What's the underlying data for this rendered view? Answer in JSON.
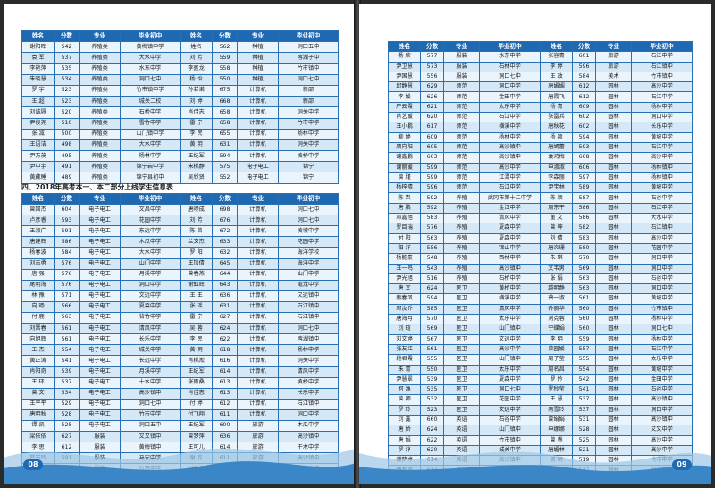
{
  "pages": {
    "left": {
      "page_number": "08",
      "table1": {
        "headers": [
          "姓名",
          "分数",
          "专业",
          "毕业初中",
          "姓名",
          "分数",
          "专业",
          "毕业初中"
        ],
        "rows": [
          [
            "谢阳晖",
            "542",
            "养殖类",
            "黄梅镇中学",
            "姓名",
            "562",
            "种植",
            "洞口五中"
          ],
          [
            "袁 军",
            "537",
            "养殖类",
            "大水中学",
            "刘 芳",
            "559",
            "种植",
            "蓉湖子中"
          ],
          [
            "李艳萍",
            "535",
            "养殖类",
            "水东中学",
            "李盈龙",
            "558",
            "种植",
            "竹市镇中"
          ],
          [
            "朱晓慧",
            "534",
            "养殖类",
            "洞口七中",
            "杨 怡",
            "550",
            "种植",
            "洞口七中"
          ],
          [
            "罗 宇",
            "523",
            "养殖类",
            "竹市镇中学",
            "孙若诺",
            "675",
            "计算机",
            "新邵"
          ],
          [
            "王 超",
            "523",
            "养殖类",
            "城关二校",
            "刘 婷",
            "668",
            "计算机",
            "新邵"
          ],
          [
            "刘诚珮",
            "520",
            "养殖类",
            "石桥中学",
            "肖佳志",
            "658",
            "计算机",
            "洞关中学"
          ],
          [
            "尹俊尧",
            "510",
            "养殖类",
            "雪竹中学",
            "雷 宁",
            "658",
            "计算机",
            "竹市中学"
          ],
          [
            "张 减",
            "500",
            "养殖类",
            "山门镇中学",
            "李 民",
            "655",
            "计算机",
            "杨林中学"
          ],
          [
            "王语洁",
            "498",
            "养殖类",
            "大水中学",
            "黄 玥",
            "631",
            "计算机",
            "洞关中学"
          ],
          [
            "尹万茂",
            "495",
            "养殖类",
            "杨林中学",
            "王纪军",
            "594",
            "计算机",
            "黄桥中学"
          ],
          [
            "尹中宇",
            "491",
            "养殖类",
            "锦宁岩中学",
            "宋桃静",
            "575",
            "电子电工",
            "锦宁"
          ],
          [
            "黄藏睡",
            "489",
            "养殖类",
            "锦宁县初中",
            "吴欣贤",
            "552",
            "电子电工",
            "锦宁"
          ]
        ]
      },
      "section_title": "四、2018年高考本一、本二部分上线学生信息表",
      "table2": {
        "headers": [
          "姓名",
          "分数",
          "专业",
          "毕业初中",
          "姓名",
          "分数",
          "专业",
          "毕业初中"
        ],
        "rows": [
          [
            "曾国杰",
            "604",
            "电子电工",
            "文昌中学",
            "唐旸成",
            "698",
            "计算机",
            "洞口七中"
          ],
          [
            "卢彦睿",
            "593",
            "电子电工",
            "花园中学",
            "刘 芳",
            "676",
            "计算机",
            "洞口七中"
          ],
          [
            "王淑广",
            "591",
            "电子电工",
            "东远中学",
            "陈 曾",
            "672",
            "计算机",
            "黄坡中学"
          ],
          [
            "唐建辉",
            "586",
            "电子电工",
            "木瓜中学",
            "兰文杰",
            "633",
            "计算机",
            "花园中学"
          ],
          [
            "杨春波",
            "584",
            "电子电工",
            "大水中学",
            "罗 阳",
            "632",
            "计算机",
            "海洋学校"
          ],
          [
            "刘志勇",
            "576",
            "电子电工",
            "山门中学",
            "王加倩",
            "645",
            "计算机",
            "海洋中学"
          ],
          [
            "唐 强",
            "576",
            "电子电工",
            "月溪中学",
            "曾春燕",
            "644",
            "计算机",
            "山门中学"
          ],
          [
            "尾明海",
            "576",
            "电子电工",
            "洞口中学",
            "谢虹辉",
            "643",
            "计算机",
            "竜龙中学"
          ],
          [
            "林 豫",
            "571",
            "电子电工",
            "文远中学",
            "王 王",
            "636",
            "计算机",
            "又远镇中"
          ],
          [
            "向 旸",
            "566",
            "电子电工",
            "夏森中学",
            "张 瑶",
            "631",
            "计算机",
            "石江镇中"
          ],
          [
            "付 鹿",
            "563",
            "电子电工",
            "背竹中学",
            "雷 宁",
            "627",
            "计算机",
            "石江镇中"
          ],
          [
            "刘晋春",
            "561",
            "电子电工",
            "清风中学",
            "吴 蓉",
            "624",
            "计算机",
            "洞口七中"
          ],
          [
            "向旭辉",
            "561",
            "电子电工",
            "长乐中学",
            "李 民",
            "622",
            "计算机",
            "蓉湖镇中"
          ],
          [
            "王 杰",
            "554",
            "电子电工",
            "城关中学",
            "黄 玥",
            "618",
            "计算机",
            "杨林中学"
          ],
          [
            "黄正涛",
            "541",
            "电子电工",
            "长远中学",
            "肖桃淞",
            "616",
            "计算机",
            "洞关中学"
          ],
          [
            "肖阳奇",
            "539",
            "电子电工",
            "月溪中学",
            "王纪军",
            "614",
            "计算机",
            "清风中学"
          ],
          [
            "王 环",
            "537",
            "电子电工",
            "十水中学",
            "张雨桑",
            "613",
            "计算机",
            "黄桥中学"
          ],
          [
            "曾 文",
            "534",
            "电子电工",
            "高沙镇中",
            "肖佳志",
            "613",
            "计算机",
            "长乐中学"
          ],
          [
            "王平平",
            "529",
            "电子电工",
            "洞口七中",
            "付 婷",
            "612",
            "计算机",
            "石江镇中"
          ],
          [
            "唐明秋",
            "528",
            "电子电工",
            "竹市中学",
            "付飞翔",
            "611",
            "计算机",
            "洞口中学"
          ],
          [
            "谭 凯",
            "528",
            "电子电工",
            "洞口五中",
            "王纪军",
            "600",
            "旅游",
            "木瓜中学"
          ],
          [
            "梁依依",
            "627",
            "服装",
            "又又镇中",
            "曾梦萍",
            "636",
            "旅游",
            "高沙镇中"
          ],
          [
            "李 思",
            "612",
            "服装",
            "黄梅镇中",
            "王可儿",
            "614",
            "旅游",
            "干木中学"
          ],
          [
            "严玉玲",
            "591",
            "服装",
            "马安中学",
            "谢 欢",
            "611",
            "旅游",
            "高沙镇中"
          ],
          [
            "尹淑倩",
            "589",
            "服装",
            "竹市中学",
            "付千莉",
            "610",
            "旅游",
            "黄坡中学"
          ]
        ]
      }
    },
    "right": {
      "page_number": "09",
      "table": {
        "headers": [
          "姓名",
          "分数",
          "专业",
          "毕业初中",
          "姓名",
          "分数",
          "专业",
          "毕业初中"
        ],
        "rows": [
          [
            "杨 欣",
            "577",
            "服装",
            "水东中学",
            "张容青",
            "601",
            "旅游",
            "石江中学"
          ],
          [
            "尹卫慧",
            "573",
            "服装",
            "石林中学",
            "李 婷",
            "596",
            "旅游",
            "石江镇中"
          ],
          [
            "尹国慧",
            "556",
            "服装",
            "洞口七中",
            "王 政",
            "584",
            "美术",
            "竹市镇中"
          ],
          [
            "邱静慧",
            "629",
            "师范",
            "洞口中学",
            "唐媚媚",
            "612",
            "园林",
            "高沙中学"
          ],
          [
            "李 媛",
            "626",
            "师范",
            "金田中学",
            "唐霞飞",
            "612",
            "园林",
            "石江中学"
          ],
          [
            "严云霞",
            "621",
            "师范",
            "太乐中学",
            "杨 青",
            "609",
            "园林",
            "杨林中学"
          ],
          [
            "肖艺媛",
            "620",
            "师范",
            "石江中学",
            "张雷兵",
            "602",
            "园林",
            "洞口中学"
          ],
          [
            "王小鹏",
            "617",
            "师范",
            "横溪中学",
            "唐秋花",
            "602",
            "园林",
            "长乐中学"
          ],
          [
            "柳 婷",
            "609",
            "师范",
            "杨林中学",
            "杨 颖",
            "594",
            "园林",
            "黄坡中学"
          ],
          [
            "周向阳",
            "605",
            "师范",
            "高沙镇中",
            "唐嫣蕾",
            "593",
            "园林",
            "石江中学"
          ],
          [
            "谢鑫鹏",
            "603",
            "师范",
            "高沙镇中",
            "袁鸿梅",
            "608",
            "园林",
            "高沙中学"
          ],
          [
            "谢丽媛",
            "599",
            "师范",
            "高沙中学",
            "申淑淑",
            "606",
            "园林",
            "杨林镇中"
          ],
          [
            "曾 瑾",
            "599",
            "师范",
            "江潭中学",
            "李森丽",
            "597",
            "园林",
            "杨林镇中"
          ],
          [
            "杨梓晴",
            "596",
            "师范",
            "石江中学",
            "尹宝林",
            "589",
            "园林",
            "黄坡中学"
          ],
          [
            "陈 梨",
            "592",
            "养殖",
            "武冈市第十二中学",
            "陈 颖",
            "587",
            "园林",
            "石谷中学"
          ],
          [
            "唐 鹏",
            "592",
            "养殖",
            "金江中学",
            "周东平",
            "586",
            "园林",
            "石江中学"
          ],
          [
            "邓嘉旭",
            "583",
            "养殖",
            "清风中学",
            "董 文",
            "586",
            "园林",
            "大水中学"
          ],
          [
            "罗目瑞",
            "576",
            "养殖",
            "夏森中学",
            "曾 坤",
            "582",
            "园林",
            "石江镇中"
          ],
          [
            "付 阳",
            "563",
            "养殖",
            "夏森中学",
            "刘 倩",
            "583",
            "园林",
            "高沙中学"
          ],
          [
            "阳 洋",
            "556",
            "养殖",
            "锦山中学",
            "唐炎珊",
            "580",
            "园林",
            "花园中学"
          ],
          [
            "杨能豪",
            "548",
            "养殖",
            "西林中学",
            "朱 琪",
            "570",
            "园林",
            "洞口中学"
          ],
          [
            "王一鸣",
            "543",
            "养殖",
            "高沙镇中",
            "文韦男",
            "569",
            "园林",
            "洞口中学"
          ],
          [
            "尹光旭",
            "516",
            "养殖",
            "石桥中学",
            "张 娟",
            "563",
            "园林",
            "石谷中学"
          ],
          [
            "唐 文",
            "624",
            "医卫",
            "黄桥中学",
            "越明静",
            "563",
            "园林",
            "洞口中学"
          ],
          [
            "蔡春凤",
            "594",
            "医卫",
            "横溪中学",
            "萧一淑",
            "561",
            "园林",
            "黄坡中学"
          ],
          [
            "邓汝乔",
            "585",
            "医卫",
            "清风中学",
            "孙丽华",
            "560",
            "园林",
            "竹市镇中"
          ],
          [
            "唐海月",
            "570",
            "医卫",
            "太乐中学",
            "刘克蓉",
            "560",
            "园林",
            "杨林中学"
          ],
          [
            "刘 瑄",
            "569",
            "医卫",
            "山门镇中",
            "宁蝶娟",
            "560",
            "园林",
            "洞口七中"
          ],
          [
            "刘文婷",
            "567",
            "医卫",
            "文远中学",
            "李 明",
            "559",
            "园林",
            "杨林中学"
          ],
          [
            "张友红",
            "561",
            "医卫",
            "高沙中学",
            "曾园媛",
            "557",
            "园林",
            "石江中学"
          ],
          [
            "段君霞",
            "555",
            "医卫",
            "山门镇中",
            "周子莹",
            "555",
            "园林",
            "太乐中学"
          ],
          [
            "朱 青",
            "550",
            "医卫",
            "太乐中学",
            "周名昌",
            "554",
            "园林",
            "黄坡中学"
          ],
          [
            "尹慧翠",
            "539",
            "医卫",
            "夏森中学",
            "罗 妗",
            "542",
            "园林",
            "金田中学"
          ],
          [
            "何 渔",
            "535",
            "医卫",
            "洞口七中",
            "罗秒莹",
            "541",
            "园林",
            "石谷中学"
          ],
          [
            "曾 卿",
            "532",
            "医卫",
            "花园中学",
            "王 慧",
            "537",
            "园林",
            "高沙镇中"
          ],
          [
            "罗 玲",
            "523",
            "医卫",
            "文远中学",
            "向雪玲",
            "537",
            "园林",
            "洞口中学"
          ],
          [
            "刘 鑫",
            "660",
            "英语",
            "石谷中学",
            "曾娟娟",
            "531",
            "园林",
            "高沙镇中"
          ],
          [
            "唐 娇",
            "624",
            "英语",
            "山门镇中",
            "申娜娜",
            "528",
            "园林",
            "又又中学"
          ],
          [
            "唐 娟",
            "622",
            "英语",
            "竹市镇中",
            "曾 睿",
            "525",
            "园林",
            "高沙中学"
          ],
          [
            "罗 淳",
            "620",
            "英语",
            "城关中学",
            "唐媚林",
            "521",
            "园林",
            "高沙中学"
          ],
          [
            "谢梦婷",
            "614",
            "英语",
            "高沙镇中",
            "周 明",
            "519",
            "园林",
            "竹市中学"
          ],
          [
            "尹瓦萍",
            "614",
            "英语",
            "洞口中学",
            "尹丽丽",
            "517",
            "园林",
            "群峰镇中"
          ]
        ]
      }
    }
  },
  "colors": {
    "header_blue": "#1f68b2",
    "row_light": "#eaf4fc",
    "row_alt": "#d4e8f7",
    "border": "#2a6fb0"
  }
}
